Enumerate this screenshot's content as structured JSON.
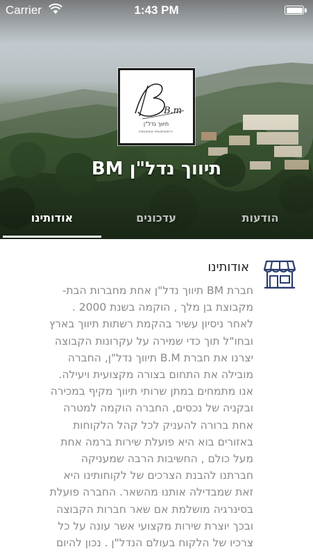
{
  "status_bar": {
    "carrier": "Carrier",
    "time": "1:43 PM",
    "battery_level": 1.0
  },
  "header": {
    "logo": {
      "monogram": "B.m",
      "hebrew_name": "תיווך נדל\"ן",
      "english_tagline": "PROPER PROPERTY"
    },
    "business_name": "תיווך נדל\"ן BM"
  },
  "tabs": [
    {
      "label": "הודעות",
      "active": false
    },
    {
      "label": "עדכונים",
      "active": false
    },
    {
      "label": "אודותינו",
      "active": true
    }
  ],
  "about": {
    "icon": "storefront-icon",
    "title": "אודותינו",
    "lines": [
      "חברת BM תיווך נדל\"ן אחת מחברות הבת-",
      "מקבוצת בן מלך , הוקמה בשנת 2000 .",
      "לאחר ניסיון עשיר בהקמת רשתות תיווך בארץ",
      "ובחו\"ל תוך כדי שמירה על עקרונות הקבוצה",
      "יצרנו את חברת B.M תיווך נדל\"ן, החברה",
      "מובילה את התחום בצורה מקצועית ויעילה.",
      "אנו מתמחים במתן שרותי תיווך מקיף במכירה",
      "ובקניה של נכסים, החברה הוקמה למטרה",
      "אחת ברורה להעניק לכל קהל הלקוחות",
      "באזורים בוא היא פועלת שירות ברמה אחת",
      "מעל כולם , החשיבות הרבה שמעניקה",
      "חברתנו להבנת הצרכים של לקוחותינו היא",
      "זאת שמבדילה אותנו מהשאר. החברה פועלת",
      "בסינרגיה מושלמת אם שאר חברות הקבוצה",
      "ובכך יוצרת שירות מקצועי אשר עונה על כל",
      "צרכיו של הלקוח בעולם הנדל\"ן . נכון להיום"
    ]
  },
  "colors": {
    "accent": "#2b3d6e",
    "body_text": "#8a8a8a",
    "title_text": "#222222"
  }
}
